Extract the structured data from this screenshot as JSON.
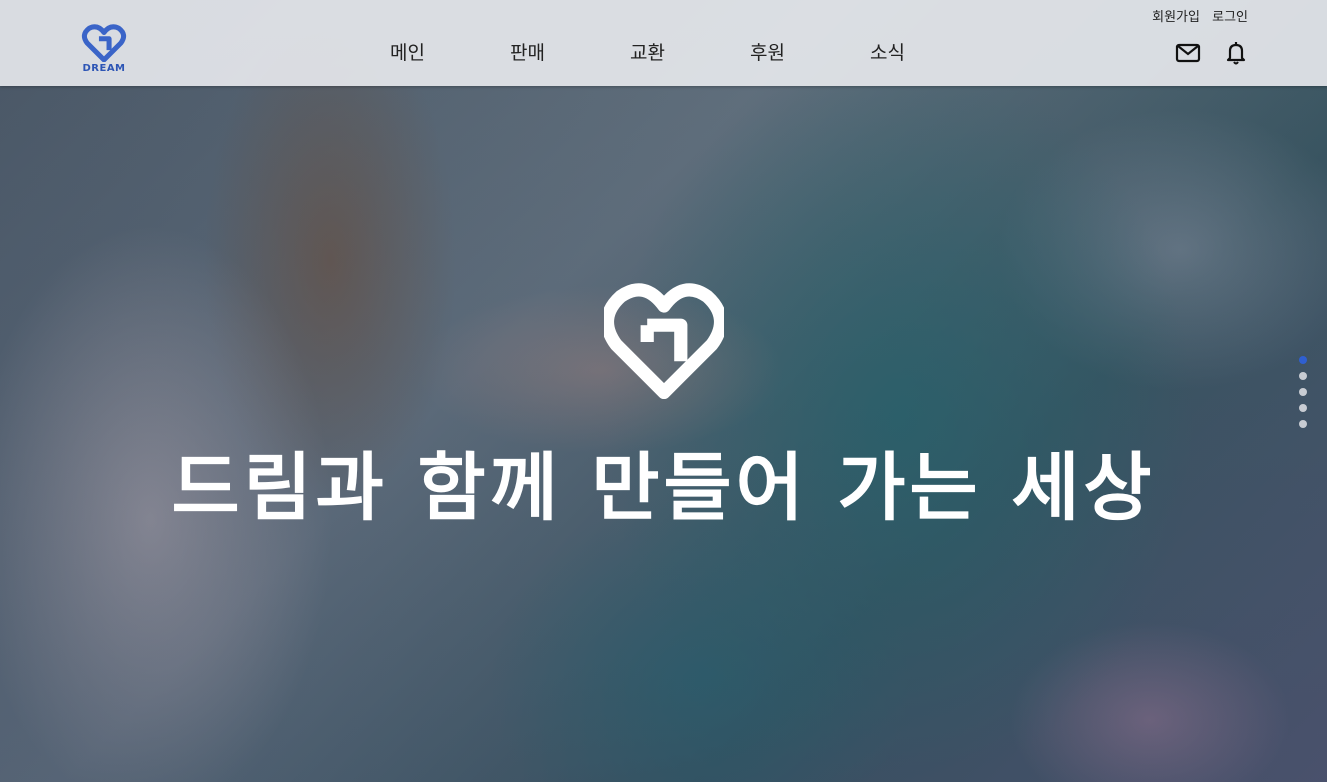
{
  "header": {
    "logo_text": "DREAM",
    "top_links": [
      "회원가입",
      "로그인"
    ],
    "nav": [
      "메인",
      "판매",
      "교환",
      "후원",
      "소식"
    ],
    "icons": [
      "mail-icon",
      "bell-icon"
    ]
  },
  "hero": {
    "headline": "드림과 함께 만들어 가는 세상",
    "slide_count": 5,
    "active_slide": 1
  },
  "colors": {
    "brand": "#2d55b5",
    "active_dot": "#2f5fd0",
    "header_bg": "#e4e6eb"
  }
}
